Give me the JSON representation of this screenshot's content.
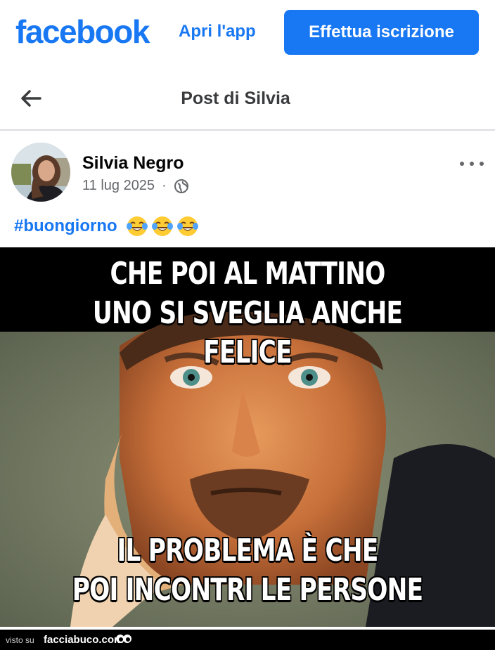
{
  "header": {
    "logo": "facebook",
    "open_app": "Apri l'app",
    "signup": "Effettua iscrizione"
  },
  "nav": {
    "title": "Post di Silvia"
  },
  "post": {
    "author": "Silvia Negro",
    "date": "11 lug 2025",
    "separator": "·",
    "text": "#buongiorno",
    "emoji_count": 3,
    "meme_top_line1": "CHE POI AL MATTINO",
    "meme_top_line2": "UNO SI SVEGLIA ANCHE FELICE",
    "meme_bottom_line1": "IL PROBLEMA È CHE",
    "meme_bottom_line2": "POI INCONTRI LE PERSONE"
  },
  "footer": {
    "visto_su": "visto su",
    "site": "facciabuco.com"
  },
  "colors": {
    "brand": "#1877f2",
    "secondary_text": "#65676b"
  },
  "icons": {
    "back": "arrow-left-icon",
    "globe": "globe-icon",
    "more": "more-horizontal-icon",
    "emoji": "tears-of-joy-emoji-icon"
  }
}
